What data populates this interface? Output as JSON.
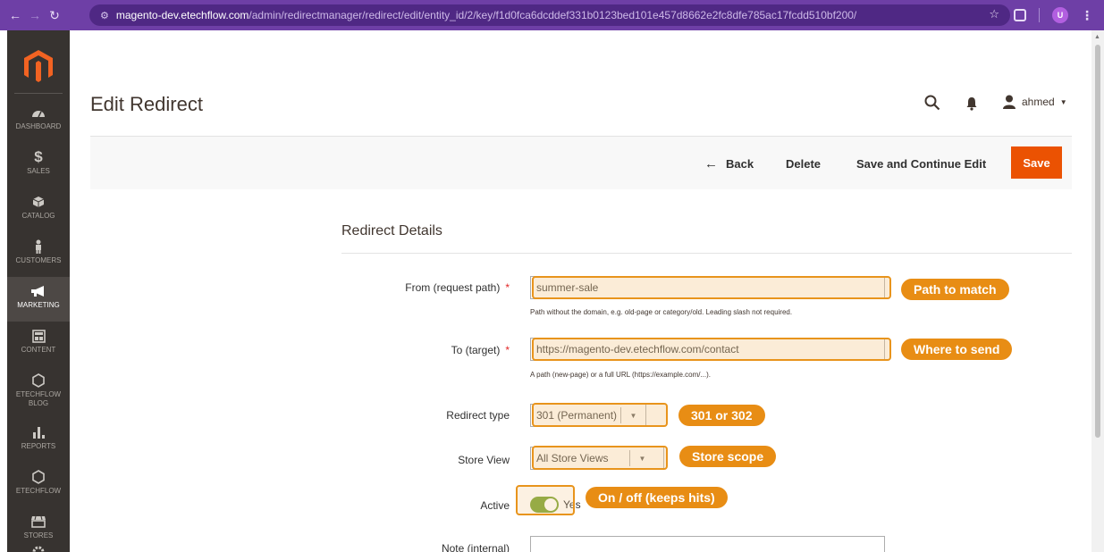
{
  "browser": {
    "url_host": "magento-dev.etechflow.com",
    "url_path": "/admin/redirectmanager/redirect/edit/entity_id/2/key/f1d0fca6dcddef331b0123bed101e457d8662e2fc8dfe785ac17fcdd510bf200/",
    "profile_initial": "U"
  },
  "sidebar": {
    "items": [
      {
        "label": "Dashboard",
        "icon": "dashboard-icon"
      },
      {
        "label": "Sales",
        "icon": "dollar-icon"
      },
      {
        "label": "Catalog",
        "icon": "box-icon"
      },
      {
        "label": "Customers",
        "icon": "person-icon"
      },
      {
        "label": "Marketing",
        "icon": "megaphone-icon"
      },
      {
        "label": "Content",
        "icon": "layout-icon"
      },
      {
        "label": "Etechflow Blog",
        "icon": "hexagon-icon"
      },
      {
        "label": "Reports",
        "icon": "bar-chart-icon"
      },
      {
        "label": "Etechflow",
        "icon": "hexagon-icon"
      },
      {
        "label": "Stores",
        "icon": "store-icon"
      }
    ],
    "active_index": 4
  },
  "header": {
    "title": "Edit Redirect",
    "username": "ahmed"
  },
  "actions": {
    "back": "Back",
    "delete": "Delete",
    "save_continue": "Save and Continue Edit",
    "save": "Save"
  },
  "form": {
    "section_title": "Redirect Details",
    "from": {
      "label": "From (request path)",
      "value": "summer-sale",
      "hint": "Path without the domain, e.g. old-page or category/old. Leading slash not required.",
      "callout": "Path to match"
    },
    "to": {
      "label": "To (target)",
      "value": "https://magento-dev.etechflow.com/contact",
      "hint": "A path (new-page) or a full URL (https://example.com/...).",
      "callout": "Where to send"
    },
    "redirect_type": {
      "label": "Redirect type",
      "value": "301 (Permanent)",
      "callout": "301 or 302"
    },
    "store_view": {
      "label": "Store View",
      "value": "All Store Views",
      "callout": "Store scope"
    },
    "active": {
      "label": "Active",
      "value": "Yes",
      "on": true,
      "callout": "On / off (keeps hits)"
    },
    "note": {
      "label": "Note (internal)"
    }
  },
  "colors": {
    "brand_orange": "#eb5202",
    "callout_orange": "#e88d14",
    "sidebar_bg": "#373330",
    "chrome_purple": "#6e3fa6",
    "toggle_green": "#79a22e"
  }
}
